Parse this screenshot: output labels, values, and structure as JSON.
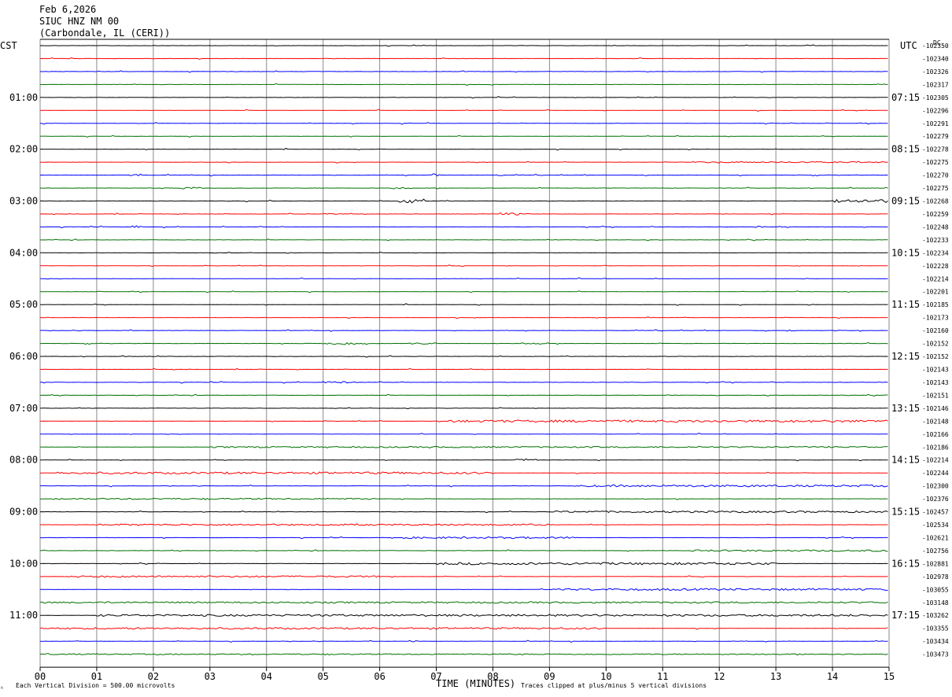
{
  "header": {
    "date": "Feb 6,2026",
    "station": "SIUC HNZ NM 00",
    "location": "(Carbondale, IL (CERI))"
  },
  "left_zone": "CST",
  "right_zone": "UTC",
  "dc_label": "DC",
  "footer": {
    "scale": "Each Vertical Division =  500.00 microvolts",
    "xlabel": "TIME (MINUTES)",
    "clip": "Traces clipped at plus/minus 5 vertical divisions",
    "mark": "ᴬ"
  },
  "chart_data": {
    "type": "line",
    "title": "SIUC HNZ NM 00",
    "xlabel": "TIME (MINUTES)",
    "xlim": [
      0,
      15
    ],
    "x_ticks": [
      "00",
      "01",
      "02",
      "03",
      "04",
      "05",
      "06",
      "07",
      "08",
      "09",
      "10",
      "11",
      "12",
      "13",
      "14",
      "15"
    ],
    "trace_colors": [
      "#000000",
      "#ff0000",
      "#0000ff",
      "#007000"
    ],
    "cst_labels": [
      "01:00",
      "02:00",
      "03:00",
      "04:00",
      "05:00",
      "06:00",
      "07:00",
      "08:00",
      "09:00",
      "10:00",
      "11:00"
    ],
    "utc_labels": [
      "07:15",
      "08:15",
      "09:15",
      "10:15",
      "11:15",
      "12:15",
      "13:15",
      "14:15",
      "15:15",
      "16:15",
      "17:15"
    ],
    "dc_offsets": [
      "-102350",
      "-102340",
      "-102326",
      "-102317",
      "-102305",
      "-102296",
      "-102291",
      "-102279",
      "-102278",
      "-102275",
      "-102270",
      "-102275",
      "-102268",
      "-102259",
      "-102248",
      "-102233",
      "-102234",
      "-102228",
      "-102214",
      "-102201",
      "-102185",
      "-102173",
      "-102160",
      "-102152",
      "-102152",
      "-102143",
      "-102143",
      "-102151",
      "-102146",
      "-102148",
      "-102166",
      "-102186",
      "-102214",
      "-102244",
      "-102300",
      "-102376",
      "-102457",
      "-102534",
      "-102621",
      "-102756",
      "-102881",
      "-102978",
      "-103055",
      "-103148",
      "-103262",
      "-103355",
      "-103434",
      "-103473"
    ],
    "activity": [
      [
        0,
        []
      ],
      [
        1,
        []
      ],
      [
        2,
        []
      ],
      [
        3,
        []
      ],
      [
        4,
        []
      ],
      [
        5,
        []
      ],
      [
        6,
        []
      ],
      [
        7,
        []
      ],
      [
        8,
        []
      ],
      [
        9,
        [
          [
            11.5,
            15,
            0.7
          ]
        ]
      ],
      [
        10,
        [
          [
            1.5,
            1.8,
            1.5
          ],
          [
            6.9,
            7.1,
            2
          ],
          [
            8,
            8.2,
            1
          ]
        ]
      ],
      [
        11,
        [
          [
            2.5,
            2.9,
            1.5
          ],
          [
            6.2,
            6.6,
            1
          ]
        ]
      ],
      [
        12,
        [
          [
            6.3,
            6.8,
            2.5
          ],
          [
            14,
            15,
            2
          ]
        ]
      ],
      [
        13,
        [
          [
            8.1,
            8.5,
            1.5
          ],
          [
            5,
            5.3,
            1
          ]
        ]
      ],
      [
        14,
        [
          [
            1.6,
            1.8,
            1.5
          ],
          [
            12.6,
            12.8,
            1
          ]
        ]
      ],
      [
        15,
        []
      ],
      [
        16,
        []
      ],
      [
        17,
        []
      ],
      [
        18,
        []
      ],
      [
        19,
        []
      ],
      [
        20,
        []
      ],
      [
        21,
        []
      ],
      [
        22,
        [
          [
            13.2,
            13.4,
            1
          ],
          [
            14,
            14.2,
            1
          ]
        ]
      ],
      [
        23,
        [
          [
            5,
            5.8,
            1.6
          ],
          [
            6.5,
            7,
            1
          ],
          [
            8.5,
            9,
            1
          ]
        ]
      ],
      [
        24,
        []
      ],
      [
        25,
        []
      ],
      [
        26,
        [
          [
            5,
            5.6,
            1
          ]
        ]
      ],
      [
        27,
        []
      ],
      [
        28,
        []
      ],
      [
        29,
        [
          [
            7,
            15,
            1.4
          ]
        ]
      ],
      [
        30,
        []
      ],
      [
        31,
        [
          [
            3,
            15,
            0.8
          ]
        ]
      ],
      [
        32,
        [
          [
            8.4,
            8.8,
            1.5
          ]
        ]
      ],
      [
        33,
        [
          [
            0.3,
            8,
            1.2
          ]
        ]
      ],
      [
        34,
        [
          [
            9.5,
            15,
            1.2
          ]
        ]
      ],
      [
        35,
        [
          [
            0.2,
            6,
            0.8
          ]
        ]
      ],
      [
        36,
        [
          [
            9,
            15,
            1.1
          ]
        ]
      ],
      [
        37,
        [
          [
            1,
            9,
            0.9
          ]
        ]
      ],
      [
        38,
        [
          [
            6.2,
            9.5,
            1.1
          ]
        ]
      ],
      [
        39,
        [
          [
            11.5,
            15,
            1
          ]
        ]
      ],
      [
        40,
        [
          [
            7,
            13,
            1.4
          ]
        ]
      ],
      [
        41,
        [
          [
            0.5,
            6,
            1
          ]
        ]
      ],
      [
        42,
        [
          [
            9,
            15,
            1.2
          ]
        ]
      ],
      [
        43,
        [
          [
            0,
            15,
            0.9
          ]
        ]
      ],
      [
        44,
        [
          [
            1,
            15,
            1.2
          ]
        ]
      ],
      [
        45,
        [
          [
            0,
            10,
            1
          ]
        ]
      ],
      [
        46,
        [
          [
            6.5,
            6.7,
            1
          ]
        ]
      ],
      [
        47,
        [
          [
            0,
            15,
            0.6
          ]
        ]
      ]
    ]
  }
}
